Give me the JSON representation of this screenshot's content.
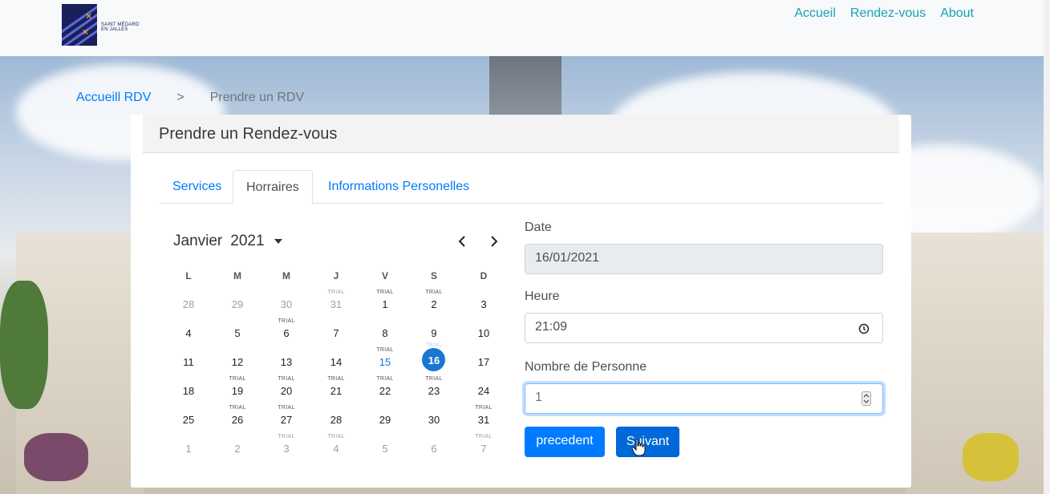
{
  "brand": {
    "logo_text_line1": "SAINT MÉDARD",
    "logo_text_line2": "EN JALLES"
  },
  "nav": [
    "Accueil",
    "Rendez-vous",
    "About"
  ],
  "breadcrumb": {
    "home": "Accueill RDV",
    "separator": ">",
    "current": "Prendre un RDV"
  },
  "card": {
    "title": "Prendre un Rendez-vous"
  },
  "tabs": [
    "Services",
    "Horraires",
    "Informations Personelles"
  ],
  "calendar": {
    "month_label": "Janvier",
    "year_label": "2021",
    "weekdays": [
      "L",
      "M",
      "M",
      "J",
      "V",
      "S",
      "D"
    ],
    "trial_label": "TRIAL",
    "weeks": [
      [
        {
          "d": "28",
          "out": true
        },
        {
          "d": "29",
          "out": true
        },
        {
          "d": "30",
          "out": true
        },
        {
          "d": "31",
          "out": true,
          "trial": true
        },
        {
          "d": "1",
          "trial": true
        },
        {
          "d": "2",
          "trial": true
        },
        {
          "d": "3"
        }
      ],
      [
        {
          "d": "4"
        },
        {
          "d": "5"
        },
        {
          "d": "6",
          "trial": true
        },
        {
          "d": "7"
        },
        {
          "d": "8"
        },
        {
          "d": "9"
        },
        {
          "d": "10"
        }
      ],
      [
        {
          "d": "11"
        },
        {
          "d": "12"
        },
        {
          "d": "13"
        },
        {
          "d": "14"
        },
        {
          "d": "15",
          "trial": true,
          "today": true
        },
        {
          "d": "16",
          "trial": true,
          "selected": true
        },
        {
          "d": "17"
        }
      ],
      [
        {
          "d": "18"
        },
        {
          "d": "19",
          "trial": true
        },
        {
          "d": "20",
          "trial": true
        },
        {
          "d": "21",
          "trial": true
        },
        {
          "d": "22",
          "trial": true
        },
        {
          "d": "23",
          "trial": true
        },
        {
          "d": "24"
        }
      ],
      [
        {
          "d": "25"
        },
        {
          "d": "26",
          "trial": true
        },
        {
          "d": "27",
          "trial": true
        },
        {
          "d": "28"
        },
        {
          "d": "29"
        },
        {
          "d": "30"
        },
        {
          "d": "31",
          "trial": true
        }
      ],
      [
        {
          "d": "1",
          "out": true
        },
        {
          "d": "2",
          "out": true
        },
        {
          "d": "3",
          "out": true,
          "trial": true
        },
        {
          "d": "4",
          "out": true,
          "trial": true
        },
        {
          "d": "5",
          "out": true
        },
        {
          "d": "6",
          "out": true
        },
        {
          "d": "7",
          "out": true,
          "trial": true
        }
      ]
    ]
  },
  "form": {
    "date_label": "Date",
    "date_value": "16/01/2021",
    "time_label": "Heure",
    "time_value": "21:09",
    "people_label": "Nombre de Personne",
    "people_value": "1"
  },
  "buttons": {
    "prev": "precedent",
    "next": "Suivant"
  },
  "colors": {
    "primary": "#007bff",
    "nav_link": "#17a2b8",
    "selected_day": "#1976d2"
  }
}
